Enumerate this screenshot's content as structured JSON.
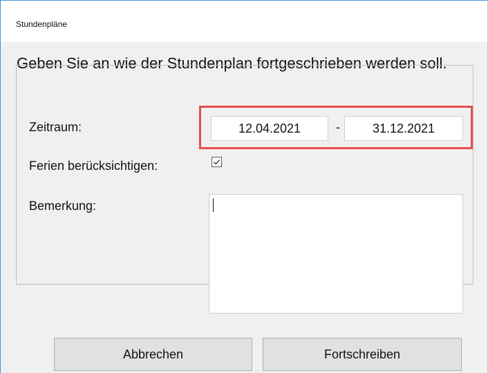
{
  "window": {
    "title": "Stundenpläne"
  },
  "instruction": "Geben Sie an wie der Stundenplan fortgeschrieben werden soll.",
  "form": {
    "zeitraum_label": "Zeitraum:",
    "start_date": "12.04.2021",
    "separator": "-",
    "end_date": "31.12.2021",
    "ferien_label": "Ferien berücksichtigen:",
    "ferien_checked": true,
    "bemerkung_label": "Bemerkung:",
    "bemerkung_value": ""
  },
  "buttons": {
    "cancel": "Abbrechen",
    "continue": "Fortschreiben"
  },
  "colors": {
    "highlight": "#e74c4c",
    "accent": "#4a90d9"
  }
}
